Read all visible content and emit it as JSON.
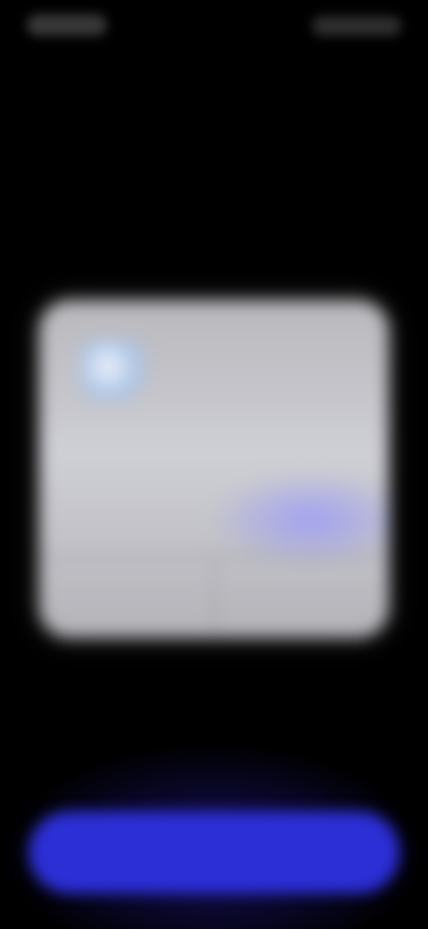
{
  "status_bar": {
    "time": "",
    "indicators": ""
  },
  "dialog": {
    "icon": "app-icon",
    "message": "",
    "left_button_label": "",
    "right_button_label": ""
  },
  "bottom": {
    "primary_button_label": ""
  },
  "colors": {
    "background": "#000000",
    "dialog": "#c4c4ca",
    "primary": "#2c2fd6"
  }
}
